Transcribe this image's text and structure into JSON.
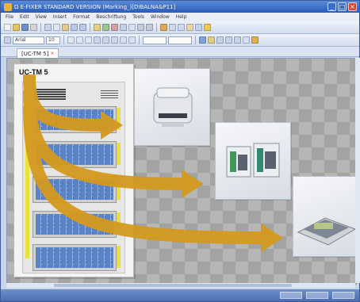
{
  "window": {
    "title": "Ω E-FIXER  STANDARD VERSION   (Marking_)[DIBALNA&P11]",
    "buttons": {
      "minimize": "_",
      "maximize": "□",
      "close": "×"
    }
  },
  "menubar": {
    "items": [
      "File",
      "Edit",
      "View",
      "Insert",
      "Format",
      "Beschriftung",
      "Tools",
      "Window",
      "Help"
    ]
  },
  "toolbar": {
    "font_combo": "Arial",
    "size_combo": "10"
  },
  "document": {
    "tab_label": "[UC-TM 5]",
    "close": "×"
  },
  "canvas": {
    "device_label": "UC-TM 5",
    "colors": {
      "arrow": "#d49a1e",
      "yellow_strip": "#e8e23a",
      "rack_blue": "#4a72b6"
    }
  },
  "icons": {
    "app": "app-icon",
    "devices": [
      "printer-icon",
      "thermal-printers-icon",
      "marking-plotter-icon"
    ]
  }
}
